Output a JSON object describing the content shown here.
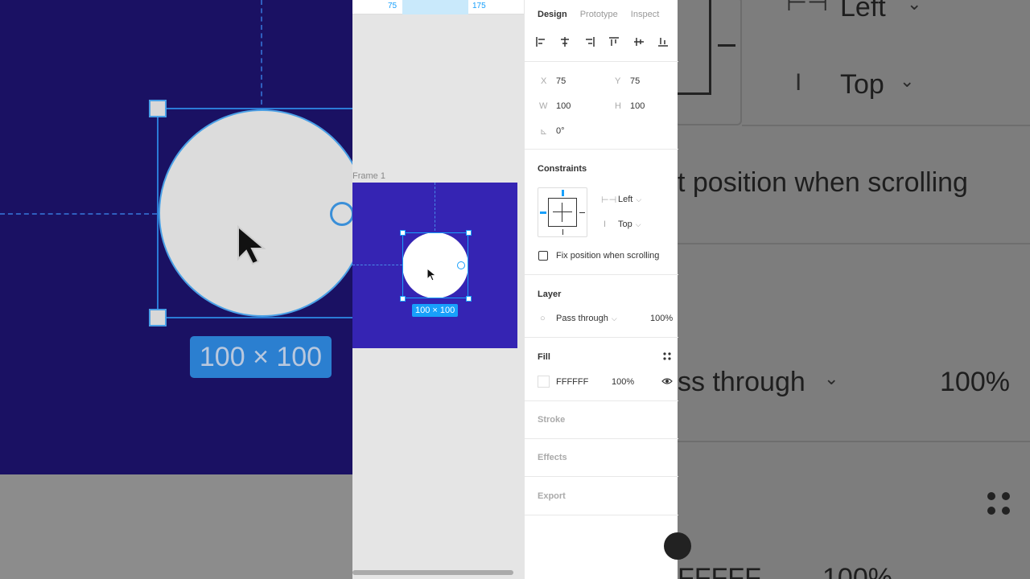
{
  "bg": {
    "size_badge": "100 × 100",
    "right": {
      "left_label": "Left",
      "top_label": "Top",
      "fix_text": "t position when scrolling",
      "blend_text": "ss through",
      "opacity_text": "100%",
      "hex_text": "FFFFF",
      "pct_text": "100%"
    }
  },
  "canvas": {
    "ruler_start": "75",
    "ruler_end": "175",
    "frame_label": "Frame 1",
    "size_label": "100 × 100"
  },
  "panel": {
    "tabs": [
      "Design",
      "Prototype",
      "Inspect"
    ],
    "active_tab": "Design",
    "x_label": "X",
    "x_value": "75",
    "y_label": "Y",
    "y_value": "75",
    "w_label": "W",
    "w_value": "100",
    "h_label": "H",
    "h_value": "100",
    "rotation": "0°",
    "constraints_title": "Constraints",
    "h_constraint": "Left",
    "v_constraint": "Top",
    "fix_scroll_label": "Fix position when scrolling",
    "layer_title": "Layer",
    "blend_mode": "Pass through",
    "layer_opacity": "100%",
    "fill_title": "Fill",
    "fill_hex": "FFFFFF",
    "fill_opacity": "100%",
    "stroke_title": "Stroke",
    "effects_title": "Effects",
    "export_title": "Export"
  },
  "colors": {
    "accent": "#18a0fb",
    "frame_fill": "#3524b3",
    "circle_fill": "#FFFFFF"
  }
}
